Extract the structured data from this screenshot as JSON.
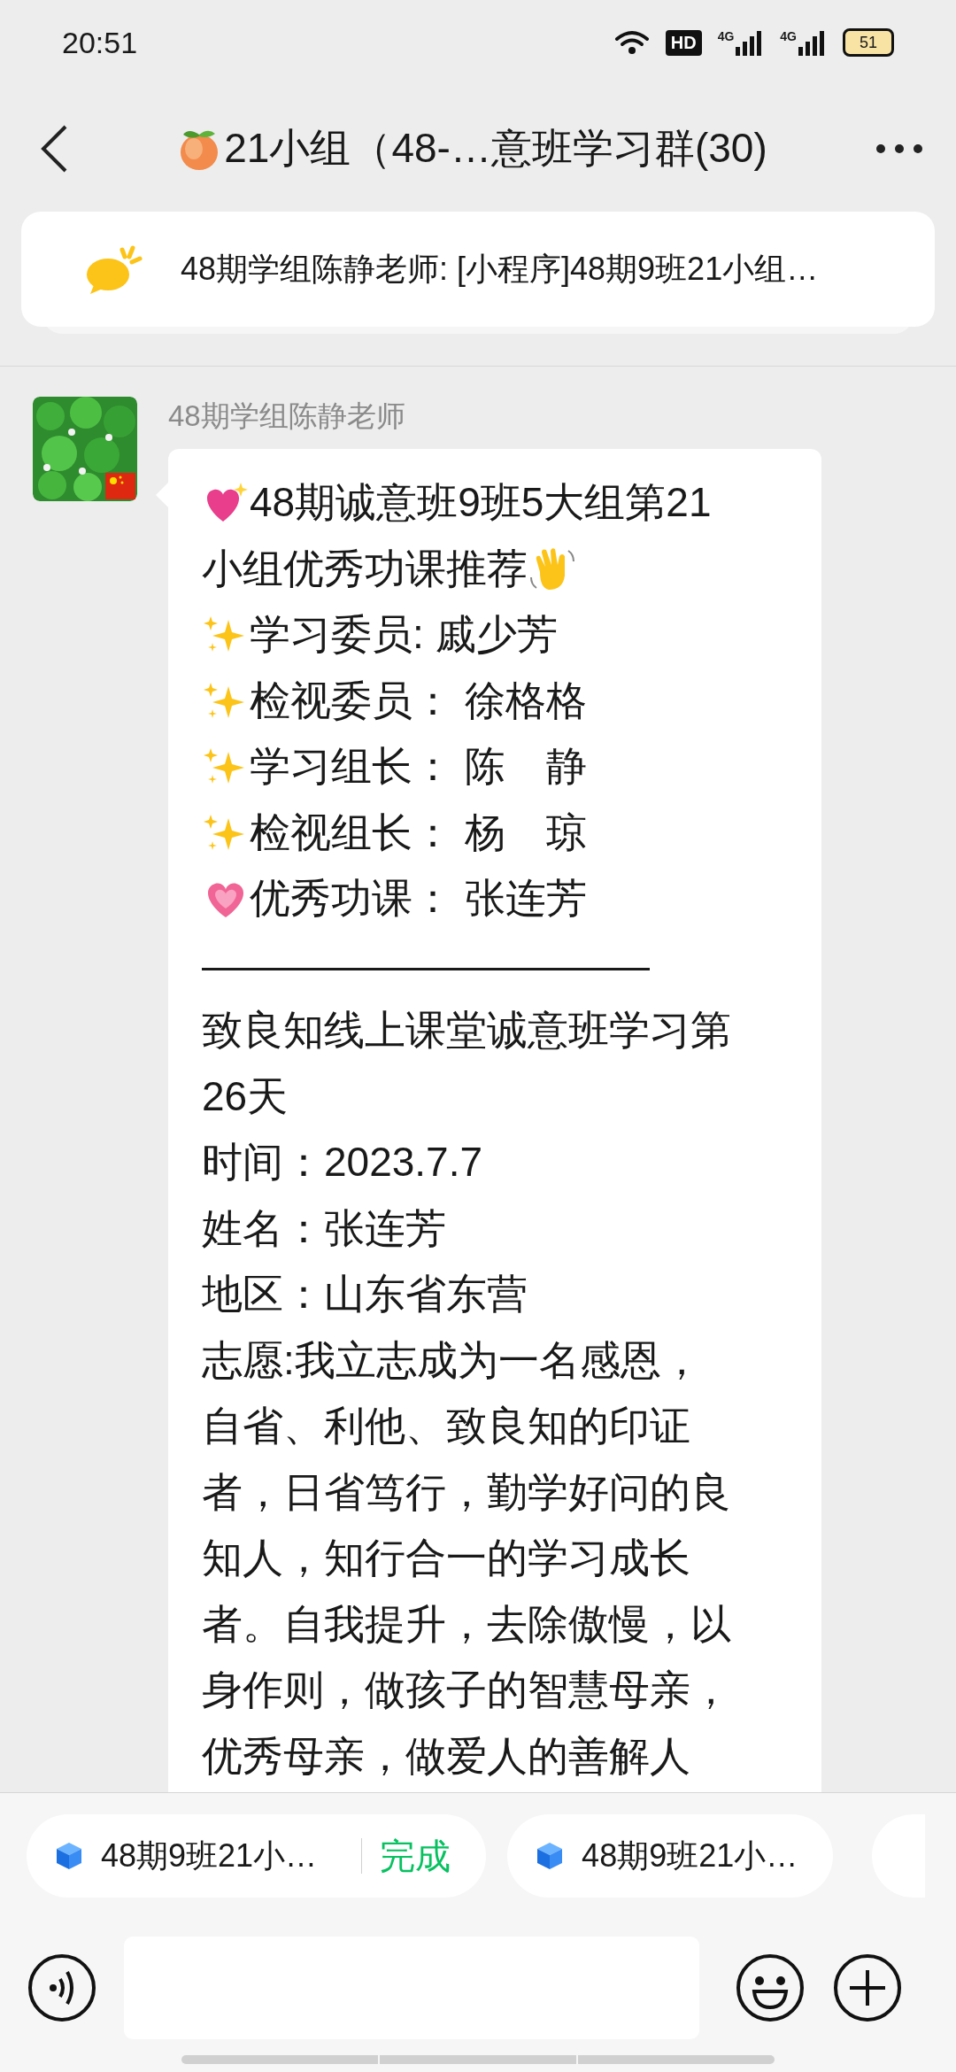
{
  "status_bar": {
    "time": "20:51",
    "hd": "HD",
    "networks": [
      "4G",
      "4G"
    ],
    "battery": "51"
  },
  "header": {
    "title": "21小组（48-…意班学习群(30)"
  },
  "pinned": {
    "text": "48期学组陈静老师: [小程序]48期9班21小组…"
  },
  "messages": [
    {
      "sender": "48期学组陈静老师",
      "lines": [
        {
          "kind": "sparkle_heart",
          "text": "48期诚意班9班5大组第21"
        },
        {
          "kind": "wave_end",
          "text": "小组优秀功课推荐"
        },
        {
          "kind": "sparkles",
          "text": "学习委员: 戚少芳"
        },
        {
          "kind": "sparkles",
          "text": "检视委员： 徐格格"
        },
        {
          "kind": "sparkles",
          "text": "学习组长： 陈　静"
        },
        {
          "kind": "sparkles",
          "text": "检视组长： 杨　琼"
        },
        {
          "kind": "heart",
          "text": "优秀功课： 张连芳"
        },
        {
          "kind": "plain",
          "text": "———————————"
        },
        {
          "kind": "plain",
          "text": "致良知线上课堂诚意班学习第"
        },
        {
          "kind": "plain",
          "text": "26天"
        },
        {
          "kind": "plain",
          "text": "时间：2023.7.7"
        },
        {
          "kind": "plain",
          "text": "姓名：张连芳"
        },
        {
          "kind": "plain",
          "text": "地区：山东省东营"
        },
        {
          "kind": "plain",
          "text": "志愿:我立志成为一名感恩，"
        },
        {
          "kind": "plain",
          "text": "自省、利他、致良知的印证"
        },
        {
          "kind": "plain",
          "text": "者，日省笃行，勤学好问的良"
        },
        {
          "kind": "plain",
          "text": "知人，知行合一的学习成长"
        },
        {
          "kind": "plain",
          "text": "者。自我提升，去除傲慢，以"
        },
        {
          "kind": "plain",
          "text": "身作则，做孩子的智慧母亲，"
        },
        {
          "kind": "plain",
          "text": "优秀母亲，做爱人的善解人"
        }
      ]
    }
  ],
  "chips": [
    {
      "title": "48期9班21小…",
      "action": "完成"
    },
    {
      "title": "48期9班21小…"
    }
  ]
}
